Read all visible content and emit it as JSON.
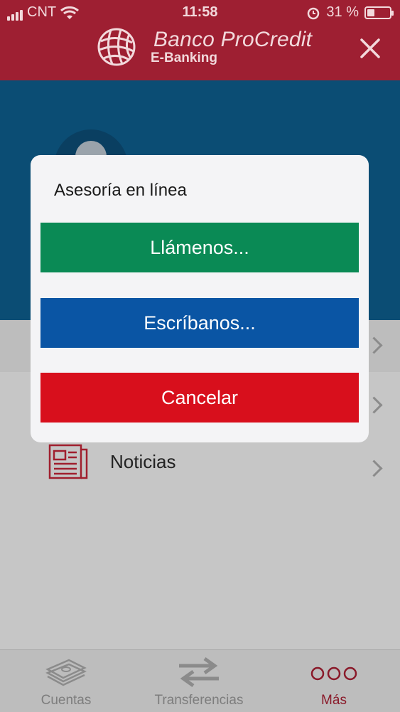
{
  "status_bar": {
    "carrier": "CNT",
    "time": "11:58",
    "battery": "31 %"
  },
  "header": {
    "brand_name": "Banco ProCredit",
    "brand_sub": "E-Banking",
    "icons": {
      "logo": "globe-logo",
      "close": "close-icon"
    }
  },
  "background_list": {
    "news_label": "Noticias"
  },
  "modal": {
    "title": "Asesoría en línea",
    "call_label": "Llámenos...",
    "write_label": "Escríbanos...",
    "cancel_label": "Cancelar"
  },
  "tabbar": {
    "items": [
      {
        "label": "Cuentas",
        "icon": "money-stack-icon"
      },
      {
        "label": "Transferencias",
        "icon": "transfer-arrows-icon"
      },
      {
        "label": "Más",
        "icon": "more-dots-icon"
      }
    ],
    "active_index": 2
  },
  "colors": {
    "header": "#9e1f32",
    "profile_band": "#0b4d74",
    "call_button": "#0a8a55",
    "write_button": "#0a55a4",
    "cancel_button": "#d80f1c"
  }
}
